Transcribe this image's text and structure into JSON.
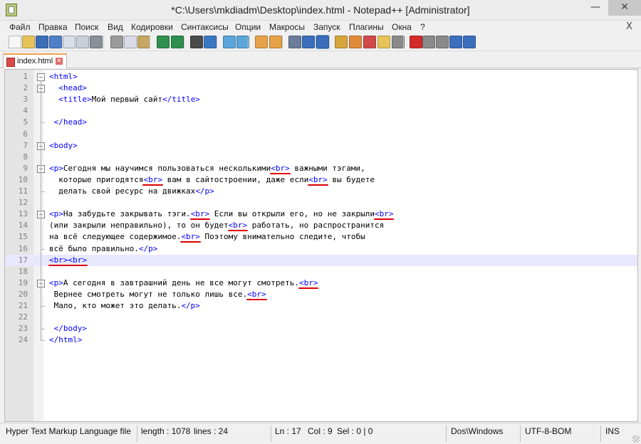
{
  "window": {
    "title": "*C:\\Users\\mkdiadm\\Desktop\\index.html - Notepad++ [Administrator]",
    "minimize": "—",
    "close": "✕"
  },
  "menu": {
    "items": [
      "Файл",
      "Правка",
      "Поиск",
      "Вид",
      "Кодировки",
      "Синтаксисы",
      "Опции",
      "Макросы",
      "Запуск",
      "Плагины",
      "Окна",
      "?"
    ],
    "close": "X"
  },
  "toolbar": {
    "buttons": [
      {
        "icon": "new-file-icon",
        "color": "#f7f7f7"
      },
      {
        "icon": "open-file-icon",
        "color": "#e7c45a"
      },
      {
        "icon": "save-icon",
        "color": "#3d6fb6"
      },
      {
        "icon": "save-all-icon",
        "color": "#4e7fc7"
      },
      {
        "icon": "close-file-icon",
        "color": "#d8dde8"
      },
      {
        "icon": "close-all-icon",
        "color": "#c9ced9"
      },
      {
        "icon": "print-icon",
        "color": "#8a8f9a"
      },
      {
        "icon": "cut-icon",
        "color": "#9a9a9a"
      },
      {
        "icon": "copy-icon",
        "color": "#d9dce8"
      },
      {
        "icon": "paste-icon",
        "color": "#c6a663"
      },
      {
        "icon": "undo-icon",
        "color": "#2f8f4f"
      },
      {
        "icon": "redo-icon",
        "color": "#2f8f4f"
      },
      {
        "icon": "find-icon",
        "color": "#4a4a4a"
      },
      {
        "icon": "replace-icon",
        "color": "#3b78c4"
      },
      {
        "icon": "zoom-in-icon",
        "color": "#5aa5d9"
      },
      {
        "icon": "zoom-out-icon",
        "color": "#5aa5d9"
      },
      {
        "icon": "sync-vertical-icon",
        "color": "#e7a24a"
      },
      {
        "icon": "sync-horizontal-icon",
        "color": "#e7a24a"
      },
      {
        "icon": "word-wrap-icon",
        "color": "#6c7d9b"
      },
      {
        "icon": "show-all-chars-icon",
        "color": "#3b6ebd"
      },
      {
        "icon": "indent-guide-icon",
        "color": "#3b6ebd"
      },
      {
        "icon": "udl-icon",
        "color": "#d6a63c"
      },
      {
        "icon": "doc-map-icon",
        "color": "#e28a3b"
      },
      {
        "icon": "function-list-icon",
        "color": "#d04a4a"
      },
      {
        "icon": "folder-workspace-icon",
        "color": "#e7c45a"
      },
      {
        "icon": "monitoring-icon",
        "color": "#8a8a8a"
      },
      {
        "icon": "record-macro-icon",
        "color": "#d42a2a"
      },
      {
        "icon": "stop-record-icon",
        "color": "#8a8a8a"
      },
      {
        "icon": "playback-icon",
        "color": "#8a8a8a"
      },
      {
        "icon": "run-macro-multiple-icon",
        "color": "#3b6ebd"
      },
      {
        "icon": "save-macro-icon",
        "color": "#3b6ebd"
      }
    ]
  },
  "tab": {
    "label": "index.html",
    "close": "✕"
  },
  "editor": {
    "lines": [
      [
        [
          "t",
          "<html>"
        ]
      ],
      [
        [
          "p",
          "  "
        ],
        [
          "t",
          "<head>"
        ]
      ],
      [
        [
          "p",
          "  "
        ],
        [
          "t",
          "<title>"
        ],
        [
          "p",
          "Мой первый сайт"
        ],
        [
          "t",
          "</title>"
        ]
      ],
      [],
      [
        [
          "p",
          " "
        ],
        [
          "t",
          "</head>"
        ]
      ],
      [],
      [
        [
          "t",
          "<body>"
        ]
      ],
      [],
      [
        [
          "t",
          "<p>"
        ],
        [
          "p",
          "Сегодня мы научимся пользоваться несколькими"
        ],
        [
          "t",
          "<br>"
        ],
        [
          "p",
          " важными тэгами,"
        ]
      ],
      [
        [
          "p",
          "  которые пригодятся"
        ],
        [
          "t",
          "<br>"
        ],
        [
          "p",
          " вам в сайтостроении, даже если"
        ],
        [
          "t",
          "<br>"
        ],
        [
          "p",
          " вы будете"
        ]
      ],
      [
        [
          "p",
          "  делать свой ресурс на движках"
        ],
        [
          "t",
          "</p>"
        ]
      ],
      [],
      [
        [
          "t",
          "<p>"
        ],
        [
          "p",
          "На забудьте закрывать тэги."
        ],
        [
          "t",
          "<br>"
        ],
        [
          "p",
          " Если вы открыли его, но не закрыли"
        ],
        [
          "t",
          "<br>"
        ]
      ],
      [
        [
          "p",
          "(или закрыли неправильно), то он будет"
        ],
        [
          "t",
          "<br>"
        ],
        [
          "p",
          " работать, но распространится"
        ]
      ],
      [
        [
          "p",
          "на всё следующее содержимое."
        ],
        [
          "t",
          "<br>"
        ],
        [
          "p",
          " Поэтому внимательно следите, чтобы"
        ]
      ],
      [
        [
          "p",
          "всё было правильно."
        ],
        [
          "t",
          "</p>"
        ]
      ],
      [
        [
          "t",
          "<br><br>"
        ]
      ],
      [],
      [
        [
          "t",
          "<p>"
        ],
        [
          "p",
          "А сегодня в завтрашний день не все могут смотреть."
        ],
        [
          "t",
          "<br>"
        ]
      ],
      [
        [
          "p",
          " Вернее смотреть могут не только лишь все."
        ],
        [
          "t",
          "<br>"
        ]
      ],
      [
        [
          "p",
          " Мало, кто может это делать."
        ],
        [
          "t",
          "</p>"
        ]
      ],
      [],
      [
        [
          "p",
          " "
        ],
        [
          "t",
          "</body>"
        ]
      ],
      [
        [
          "t",
          "</html>"
        ]
      ]
    ],
    "current_line": 17
  },
  "status": {
    "language": "Hyper Text Markup Language file",
    "length": "length : 1078",
    "lines": "lines : 24",
    "ln": "Ln : 17",
    "col": "Col : 9",
    "sel": "Sel : 0 | 0",
    "eol": "Dos\\Windows",
    "encoding": "UTF-8-BOM",
    "mode": "INS"
  }
}
